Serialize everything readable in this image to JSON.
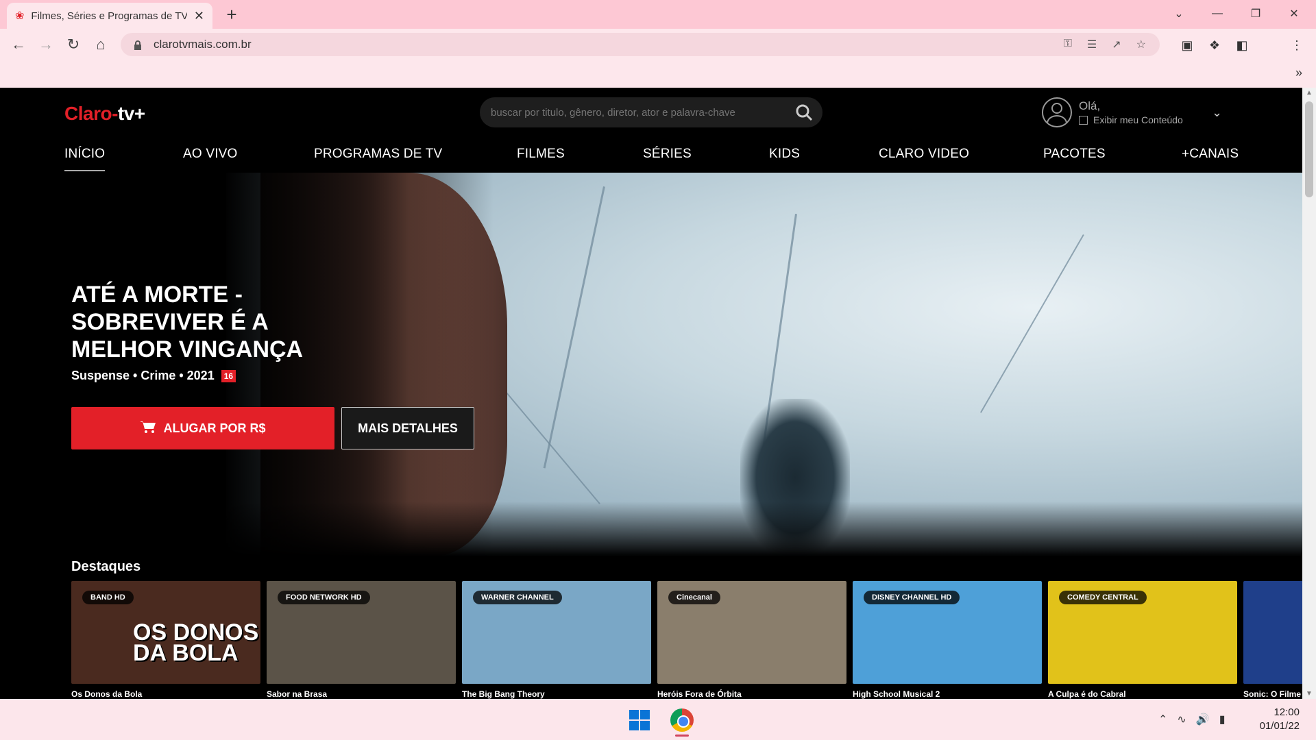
{
  "browser": {
    "tab_title": "Filmes, Séries e Programas de TV",
    "url": "clarotvmais.com.br"
  },
  "site": {
    "logo_claro": "Claro",
    "logo_tv": "tv+",
    "search_placeholder": "buscar por titulo, gênero, diretor, ator e palavra-chave",
    "greeting": "Olá,",
    "show_my_content": "Exibir meu Conteúdo",
    "nav": [
      "INÍCIO",
      "AO VIVO",
      "PROGRAMAS DE TV",
      "FILMES",
      "SÉRIES",
      "KIDS",
      "CLARO VIDEO",
      "PACOTES",
      "+CANAIS"
    ],
    "accent_color": "#e32028"
  },
  "hero": {
    "title": "ATÉ A MORTE - SOBREVIVER É A MELHOR VINGANÇA",
    "meta": "Suspense • Crime • 2021",
    "rating": "16",
    "rent_label": "ALUGAR POR R$",
    "details_label": "MAIS DETALHES"
  },
  "highlights": {
    "title": "Destaques",
    "cards": [
      {
        "channel": "BAND HD",
        "title": "Os Donos da Bola",
        "overlay": "OS DONOS DA BOLA",
        "color": "#4a2a1f"
      },
      {
        "channel": "FOOD NETWORK HD",
        "title": "Sabor na Brasa",
        "color": "#5b5348"
      },
      {
        "channel": "WARNER CHANNEL",
        "title": "The Big Bang Theory",
        "color": "#7aa7c6"
      },
      {
        "channel": "Cinecanal",
        "title": "Heróis Fora de Órbita",
        "color": "#8a7e6c"
      },
      {
        "channel": "DISNEY CHANNEL HD",
        "title": "High School Musical 2",
        "color": "#4ea0d8"
      },
      {
        "channel": "COMEDY CENTRAL",
        "title": "A Culpa é do Cabral",
        "color": "#e1c21a"
      },
      {
        "channel": "",
        "title": "Sonic: O Filme",
        "color": "#1f3f8a"
      }
    ]
  },
  "taskbar": {
    "time": "12:00",
    "date": "01/01/22"
  }
}
